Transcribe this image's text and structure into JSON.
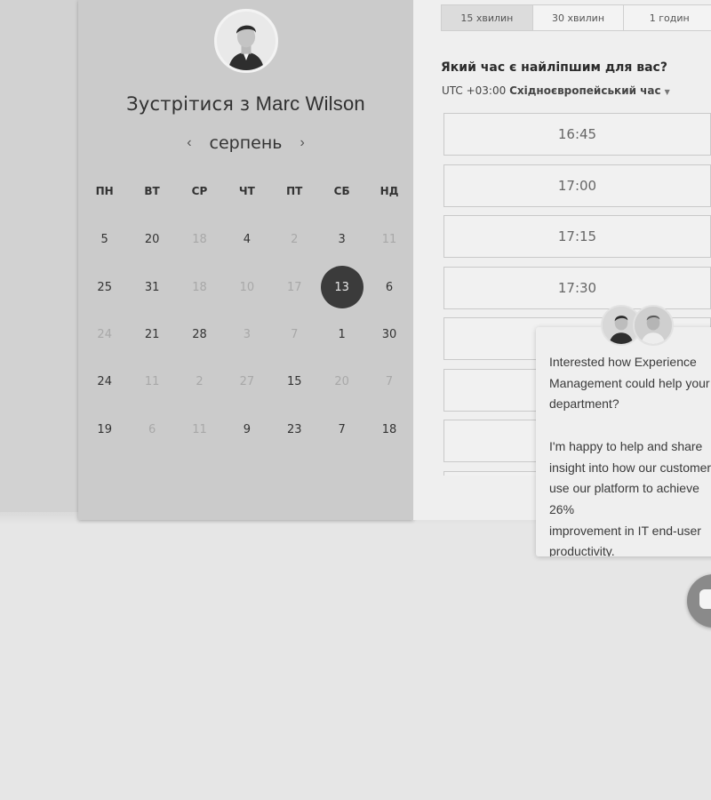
{
  "calendar": {
    "title_prefix": "Зустрітися з",
    "host_name": "Marc Wilson",
    "month": "серпень",
    "prev_icon": "‹",
    "next_icon": "›",
    "weekdays": [
      "ПН",
      "ВТ",
      "СР",
      "ЧТ",
      "ПТ",
      "СБ",
      "НД"
    ],
    "rows": [
      [
        {
          "d": "5",
          "s": "on"
        },
        {
          "d": "20",
          "s": "on"
        },
        {
          "d": "18",
          "s": "off"
        },
        {
          "d": "4",
          "s": "on"
        },
        {
          "d": "2",
          "s": "off"
        },
        {
          "d": "3",
          "s": "on"
        },
        {
          "d": "11",
          "s": "off"
        }
      ],
      [
        {
          "d": "25",
          "s": "on"
        },
        {
          "d": "31",
          "s": "on"
        },
        {
          "d": "18",
          "s": "off"
        },
        {
          "d": "10",
          "s": "off"
        },
        {
          "d": "17",
          "s": "off"
        },
        {
          "d": "13",
          "s": "sel"
        },
        {
          "d": "6",
          "s": "on"
        }
      ],
      [
        {
          "d": "24",
          "s": "off"
        },
        {
          "d": "21",
          "s": "on"
        },
        {
          "d": "28",
          "s": "on"
        },
        {
          "d": "3",
          "s": "off"
        },
        {
          "d": "7",
          "s": "off"
        },
        {
          "d": "1",
          "s": "on"
        },
        {
          "d": "30",
          "s": "on"
        }
      ],
      [
        {
          "d": "24",
          "s": "on"
        },
        {
          "d": "11",
          "s": "off"
        },
        {
          "d": "2",
          "s": "off"
        },
        {
          "d": "27",
          "s": "off"
        },
        {
          "d": "15",
          "s": "on"
        },
        {
          "d": "20",
          "s": "off"
        },
        {
          "d": "7",
          "s": "off"
        }
      ],
      [
        {
          "d": "19",
          "s": "on"
        },
        {
          "d": "6",
          "s": "off"
        },
        {
          "d": "11",
          "s": "off"
        },
        {
          "d": "9",
          "s": "on"
        },
        {
          "d": "23",
          "s": "on"
        },
        {
          "d": "7",
          "s": "on"
        },
        {
          "d": "18",
          "s": "on"
        }
      ]
    ]
  },
  "durations": [
    "15 хвилин",
    "30 хвилин",
    "1 годин"
  ],
  "active_duration_index": 0,
  "question": "Який час є найліпшим для вас?",
  "timezone": {
    "offset": "UTC +03:00",
    "name": "Східноєвропейський час"
  },
  "slots": [
    "16:45",
    "17:00",
    "17:15",
    "17:30",
    "",
    "",
    "",
    ""
  ],
  "chat": {
    "message": "Interested how Experience\nManagement could help your IT\ndepartment?\n\nI'm happy to help and share\ninsight into how our customers\nuse our platform to achieve 26%\nimprovement in IT end-user\nproductivity."
  }
}
